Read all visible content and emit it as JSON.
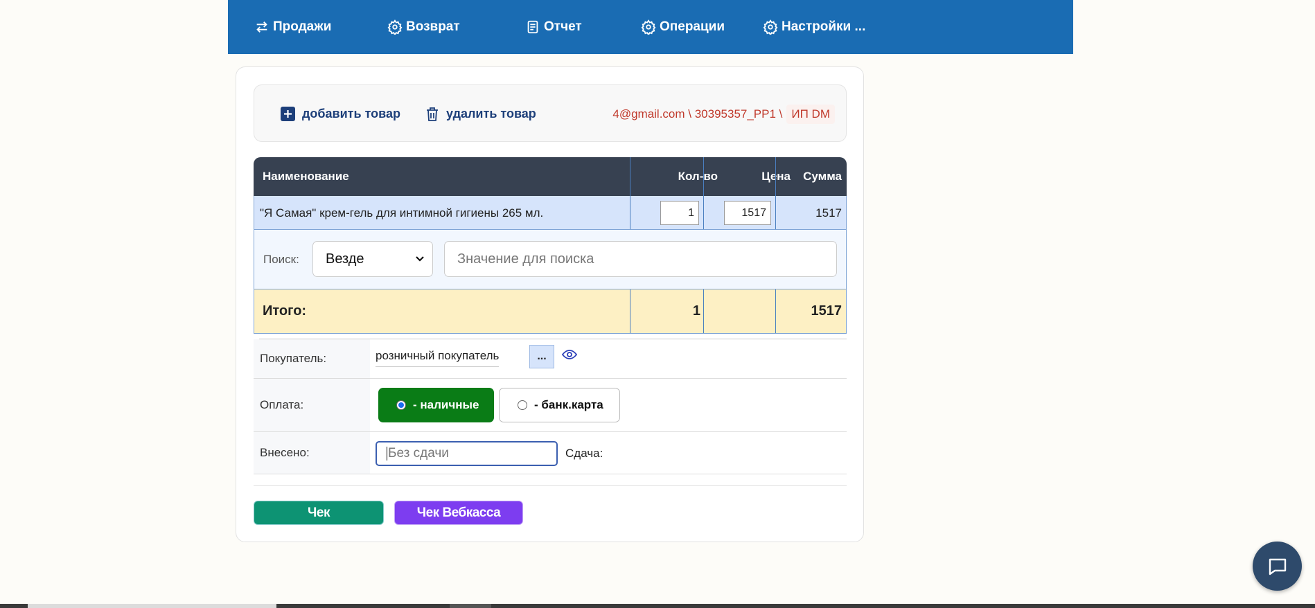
{
  "nav": {
    "items": [
      {
        "label": "Продажи",
        "icon": "arrows-swap-icon"
      },
      {
        "label": "Возврат",
        "icon": "gear-icon"
      },
      {
        "label": "Отчет",
        "icon": "document-icon"
      },
      {
        "label": "Операции",
        "icon": "gear-icon"
      },
      {
        "label": "Настройки ...",
        "icon": "gear-icon"
      }
    ]
  },
  "toolbar": {
    "add_label": "добавить товар",
    "delete_label": "удалить товар",
    "account_info": "4@gmail.com \\ 30395357_PP1 \\",
    "org_badge": "ИП DM"
  },
  "table": {
    "headers": {
      "name": "Наименование",
      "qty": "Кол-во",
      "price": "Цена",
      "sum": "Сумма"
    },
    "rows": [
      {
        "name": "\"Я Самая\" крем-гель для интимной гигиены 265 мл.",
        "qty": "1",
        "price": "1517",
        "sum": "1517"
      }
    ],
    "search": {
      "label": "Поиск:",
      "scope": "Везде",
      "placeholder": "Значение для поиска"
    },
    "total": {
      "label": "Итого:",
      "qty": "1",
      "sum": "1517"
    }
  },
  "form": {
    "buyer_label": "Покупатель:",
    "buyer_value": "розничный покупатель",
    "buyer_more": "...",
    "payment_label": "Оплата:",
    "payment_cash": "- наличные",
    "payment_card": "- банк.карта",
    "paid_label": "Внесено:",
    "paid_placeholder": "Без сдачи",
    "change_label": "Сдача:"
  },
  "actions": {
    "receipt": "Чек",
    "webkassa_receipt": "Чек Вебкасса"
  },
  "colors": {
    "nav_bg": "#1a6cb3",
    "header_bg": "#374151",
    "total_bg": "#fdf0c4",
    "cash_active": "#0a7c16",
    "receipt_btn": "#0d9373",
    "webkassa_btn": "#7d3df0"
  }
}
